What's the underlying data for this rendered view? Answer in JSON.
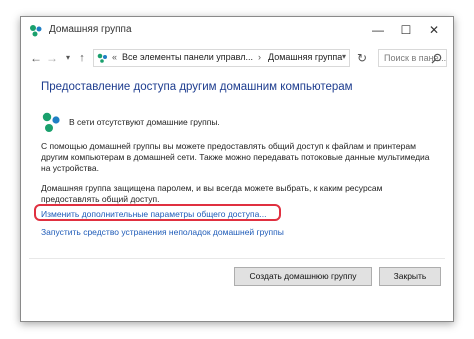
{
  "window": {
    "title": "Домашняя группа",
    "controls": {
      "minimize": "—",
      "maximize": "☐",
      "close": "✕"
    }
  },
  "navbar": {
    "back": "←",
    "forward": "→",
    "recent": "▾",
    "up": "↑",
    "breadcrumb": [
      "«",
      "Все элементы панели управл...",
      "›",
      "Домашняя группа"
    ],
    "address_dropdown": "▾",
    "refresh": "↻",
    "search_placeholder": "Поиск в пане..."
  },
  "content": {
    "heading": "Предоставление доступа другим домашним компьютерам",
    "status": "В сети отсутствуют домашние группы.",
    "paragraph1": "С помощью домашней группы вы можете предоставлять общий доступ к файлам и принтерам другим компьютерам в домашней сети. Также можно передавать потоковые данные мультимедиа на устройства.",
    "paragraph2": "Домашняя группа защищена паролем, и вы всегда можете выбрать, к каким ресурсам предоставлять общий доступ.",
    "link_advanced": "Изменить дополнительные параметры общего доступа...",
    "link_troubleshoot": "Запустить средство устранения неполадок домашней группы"
  },
  "buttons": {
    "create": "Создать домашнюю группу",
    "close": "Закрыть"
  },
  "colors": {
    "heading": "#1e3d8f",
    "link": "#1e5bb8",
    "highlight": "#e03040",
    "homegroup_icon": "#1aa06d"
  }
}
